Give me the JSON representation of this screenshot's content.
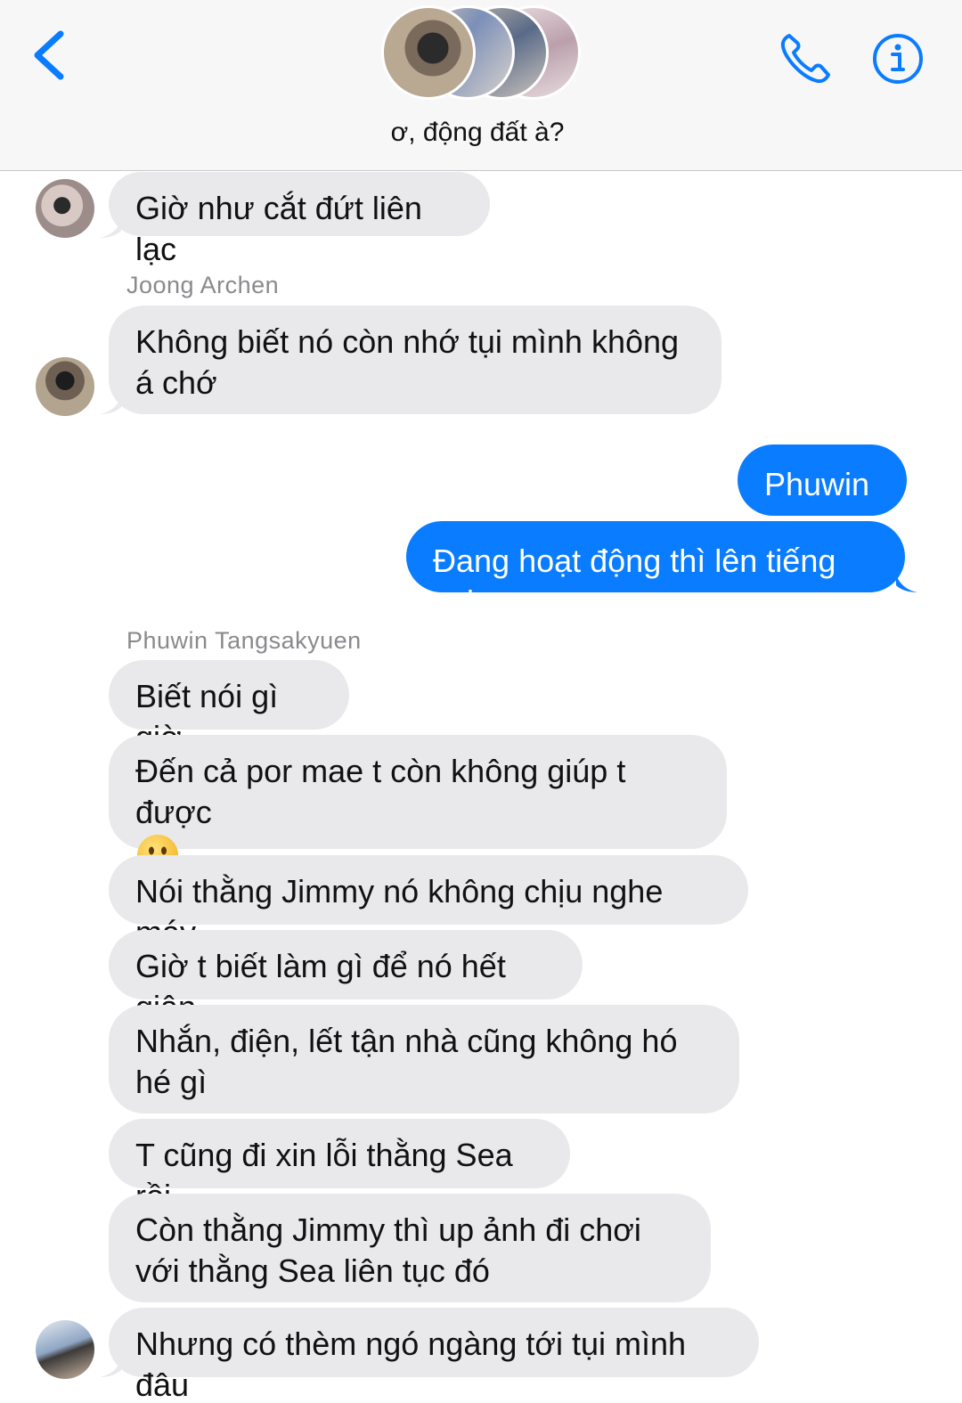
{
  "header": {
    "group_name": "ơ, động đất à?"
  },
  "icons": {
    "back": "chevron-left-icon",
    "call": "phone-icon",
    "info": "info-icon"
  },
  "colors": {
    "accent": "#0a7cff",
    "incoming_bubble": "#e9e9eb",
    "header_bg": "#f7f7f7"
  },
  "messages": [
    {
      "text": "Giờ như cắt đứt liên lạc"
    },
    {
      "sender": "Joong Archen",
      "text": "Không biết nó còn nhớ tụi mình không á chớ"
    },
    {
      "text": "Phuwin"
    },
    {
      "text": "Đang hoạt động thì lên tiếng coi"
    },
    {
      "sender": "Phuwin Tangsakyuen",
      "text": "Biết nói gì giờ"
    },
    {
      "text": "Đến cả por mae t còn không giúp t được"
    },
    {
      "text": "Nói thằng Jimmy nó không chịu nghe máy"
    },
    {
      "text": "Giờ t biết làm gì để nó hết giận"
    },
    {
      "text": "Nhắn, điện, lết tận nhà cũng không hó hé gì"
    },
    {
      "text": "T cũng đi xin lỗi thằng Sea rồi"
    },
    {
      "text": "Còn thằng Jimmy thì up ảnh đi chơi với thằng Sea liên tục đó"
    },
    {
      "text": "Nhưng có thèm ngó ngàng tới tụi mình đâu"
    }
  ]
}
